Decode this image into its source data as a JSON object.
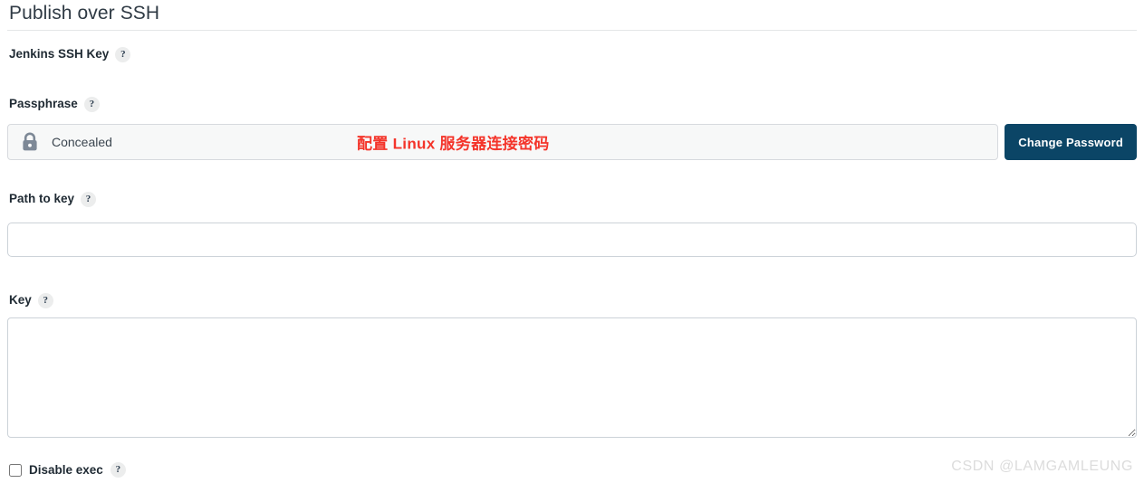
{
  "header": {
    "title": "Publish over SSH"
  },
  "fields": {
    "jenkins_ssh_key": {
      "label": "Jenkins SSH Key",
      "help": "?"
    },
    "passphrase": {
      "label": "Passphrase",
      "help": "?",
      "value_state": "Concealed",
      "lock_icon": "lock-icon",
      "annotation": "配置 Linux 服务器连接密码",
      "annotation_color": "#f4342a",
      "button_label": "Change Password",
      "button_color": "#0b4566"
    },
    "path_to_key": {
      "label": "Path to key",
      "help": "?",
      "value": "",
      "placeholder": ""
    },
    "key": {
      "label": "Key",
      "help": "?",
      "value": "",
      "placeholder": ""
    },
    "disable_exec": {
      "label": "Disable exec",
      "help": "?",
      "checked": false
    }
  },
  "watermark": {
    "text": "CSDN @LAMGAMLEUNG"
  }
}
